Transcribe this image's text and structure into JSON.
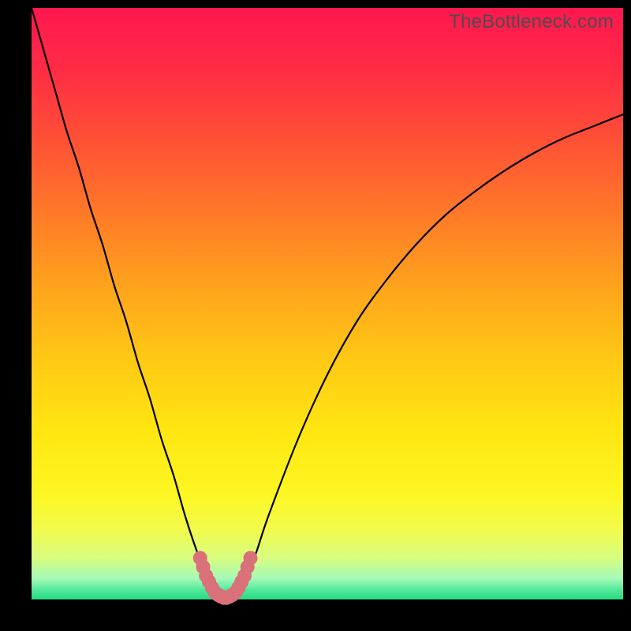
{
  "watermark": "TheBottleneck.com",
  "gradient_stops": [
    {
      "offset": 0.0,
      "color": "#ff174f"
    },
    {
      "offset": 0.1,
      "color": "#ff2b45"
    },
    {
      "offset": 0.22,
      "color": "#ff4f36"
    },
    {
      "offset": 0.35,
      "color": "#ff7a28"
    },
    {
      "offset": 0.48,
      "color": "#ffa61c"
    },
    {
      "offset": 0.6,
      "color": "#ffca14"
    },
    {
      "offset": 0.72,
      "color": "#ffe712"
    },
    {
      "offset": 0.82,
      "color": "#fdf622"
    },
    {
      "offset": 0.88,
      "color": "#f2fb4a"
    },
    {
      "offset": 0.93,
      "color": "#d8fd80"
    },
    {
      "offset": 0.965,
      "color": "#a3f9b8"
    },
    {
      "offset": 0.985,
      "color": "#4de79a"
    },
    {
      "offset": 1.0,
      "color": "#28db7e"
    }
  ],
  "chart_data": {
    "type": "line",
    "title": "",
    "xlabel": "",
    "ylabel": "",
    "xlim": [
      0,
      100
    ],
    "ylim": [
      0,
      100
    ],
    "series": [
      {
        "name": "bottleneck-curve",
        "x": [
          0,
          2,
          4,
          6,
          8,
          10,
          12,
          14,
          16,
          18,
          20,
          22,
          24,
          26,
          28,
          30,
          31,
          32,
          33,
          34,
          35,
          36,
          38,
          40,
          45,
          50,
          55,
          60,
          65,
          70,
          75,
          80,
          85,
          90,
          95,
          100
        ],
        "y": [
          100,
          93,
          86,
          79,
          73,
          66,
          60,
          53,
          47,
          40,
          34,
          27,
          21,
          14,
          8,
          3,
          1.2,
          0.5,
          0.3,
          0.5,
          1.2,
          3,
          8,
          14,
          27,
          38,
          47,
          54,
          60,
          65,
          69,
          72.5,
          75.5,
          78,
          80,
          82
        ]
      }
    ],
    "marker_band": {
      "name": "optimal-region",
      "color": "#d9707a",
      "x": [
        28.5,
        29.0,
        29.5,
        30.0,
        30.5,
        31.0,
        31.5,
        32.0,
        32.5,
        33.0,
        33.5,
        34.0,
        34.5,
        35.0,
        35.5,
        36.0,
        36.5,
        37.0
      ],
      "y": [
        7.0,
        5.5,
        4.0,
        3.0,
        2.0,
        1.2,
        0.8,
        0.5,
        0.3,
        0.3,
        0.5,
        0.8,
        1.2,
        2.0,
        3.0,
        4.0,
        5.5,
        7.0
      ]
    }
  }
}
